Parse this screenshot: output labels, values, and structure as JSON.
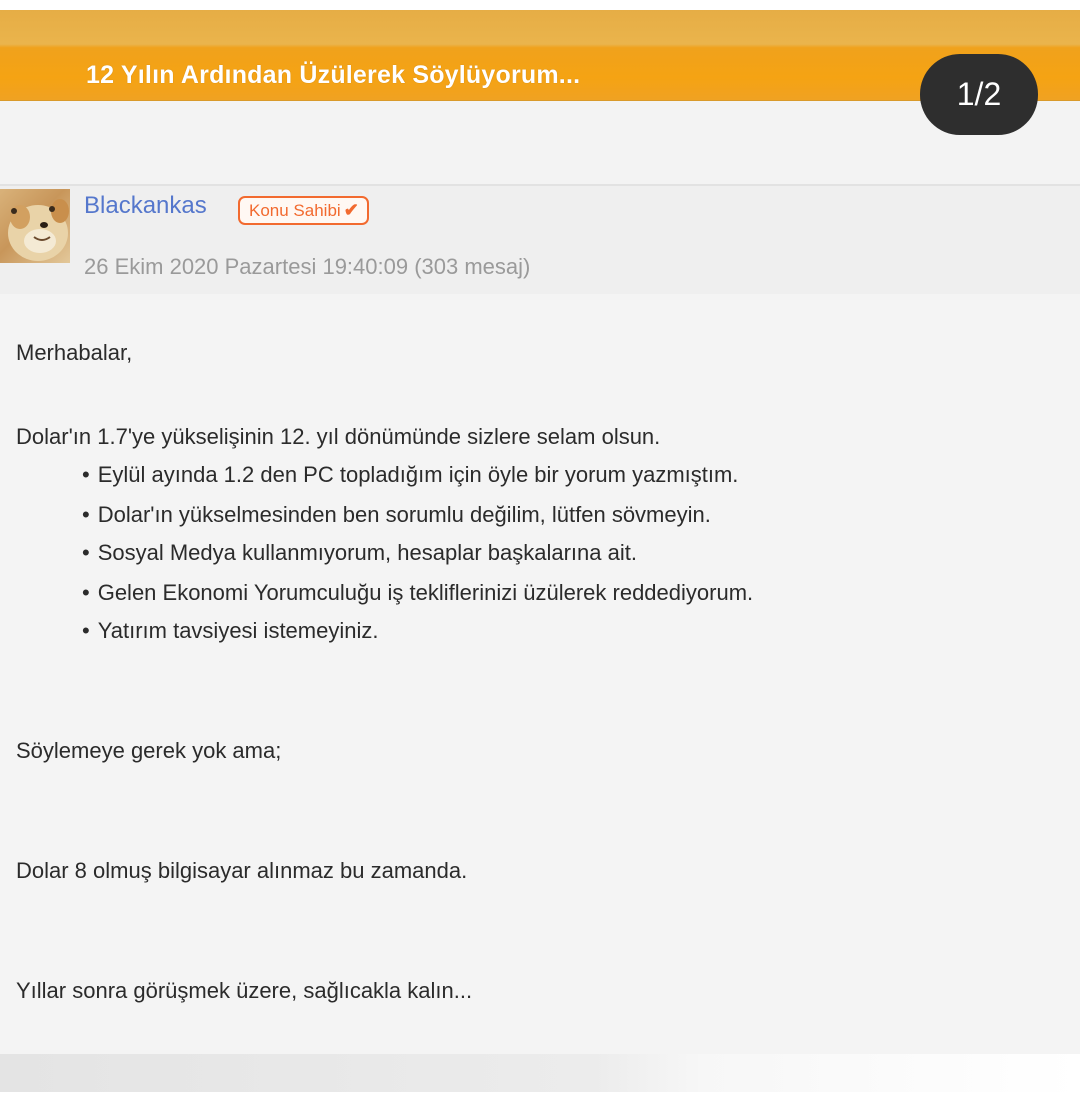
{
  "thread": {
    "title": "12 Yılın Ardından Üzülerek Söylüyorum...",
    "page_indicator": "1/2"
  },
  "post": {
    "author": "Blackankas",
    "badge_label": "Konu Sahibi",
    "badge_icon": "check-icon",
    "date_line": "26 Ekim 2020 Pazartesi 19:40:09 (303 mesaj)",
    "greeting": "Merhabalar,",
    "intro": "Dolar'ın 1.7'ye yükselişinin 12. yıl dönümünde sizlere selam olsun.",
    "bullets": [
      "Eylül ayında 1.2 den PC topladığım için öyle bir yorum yazmıştım.",
      "Dolar'ın yükselmesinden ben sorumlu değilim, lütfen sövmeyin.",
      "Sosyal Medya kullanmıyorum, hesaplar başkalarına ait.",
      "Gelen Ekonomi Yorumculuğu iş tekliflerinizi üzülerek reddediyorum.",
      "Yatırım tavsiyesi istemeyiniz."
    ],
    "line_after_1": "Söylemeye gerek yok ama;",
    "line_after_2": "Dolar 8 olmuş bilgisayar alınmaz bu zamanda.",
    "closing": "Yıllar sonra görüşmek üzere, sağlıcakla kalın..."
  },
  "colors": {
    "title_bar": "#f5a313",
    "username": "#5577cc",
    "badge": "#f26a2f",
    "page_badge_bg": "#2e2e2e"
  }
}
